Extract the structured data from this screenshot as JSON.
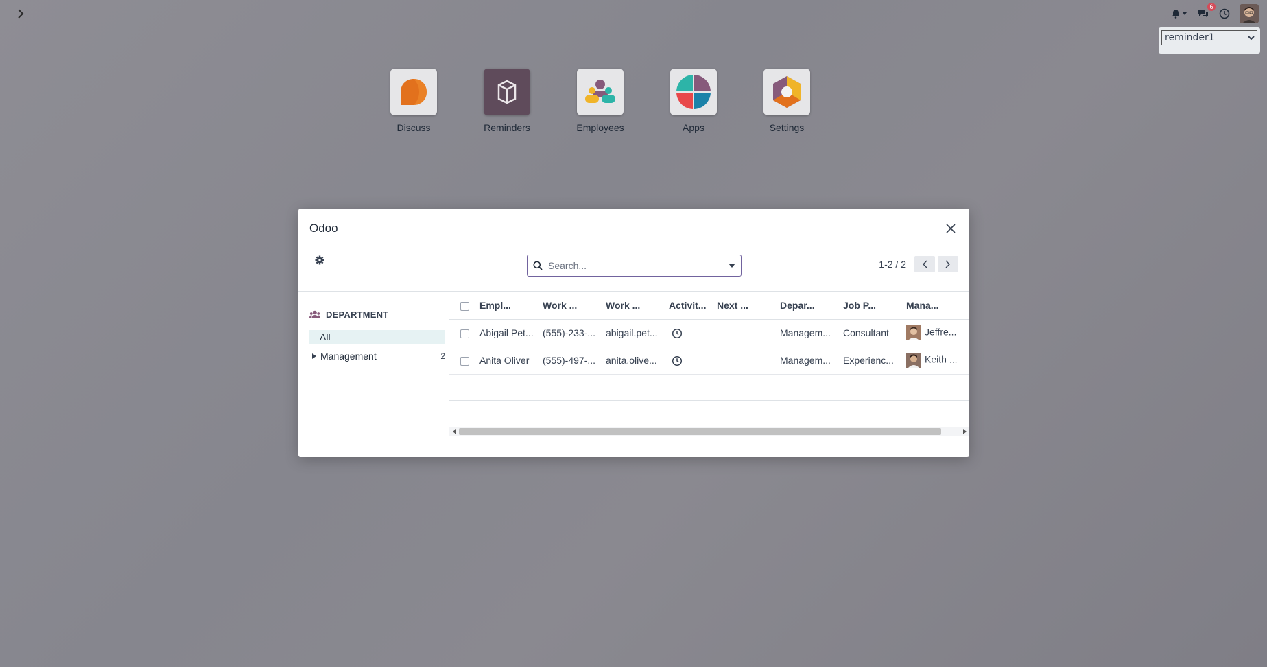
{
  "top": {
    "systray": {
      "messages_badge": "6"
    },
    "reminder_select": {
      "value": "reminder1",
      "options": [
        "reminder1"
      ]
    }
  },
  "apps": [
    {
      "label": "Discuss",
      "icon": "discuss-icon"
    },
    {
      "label": "Reminders",
      "icon": "reminders-icon"
    },
    {
      "label": "Employees",
      "icon": "employees-icon"
    },
    {
      "label": "Apps",
      "icon": "apps-icon"
    },
    {
      "label": "Settings",
      "icon": "settings-icon"
    }
  ],
  "dialog": {
    "title": "Odoo",
    "search": {
      "placeholder": "Search..."
    },
    "pager": {
      "value": "1-2 / 2"
    },
    "sidebar": {
      "header": "DEPARTMENT",
      "all_label": "All",
      "items": [
        {
          "label": "Management",
          "count": "2"
        }
      ]
    },
    "table": {
      "columns": [
        "Empl...",
        "Work ...",
        "Work ...",
        "Activit...",
        "Next ...",
        "Depar...",
        "Job P...",
        "Mana..."
      ],
      "rows": [
        {
          "name": "Abigail Pet...",
          "phone": "(555)-233-...",
          "email": "abigail.pet...",
          "next": "",
          "department": "Managem...",
          "job": "Consultant",
          "manager": "Jeffre..."
        },
        {
          "name": "Anita Oliver",
          "phone": "(555)-497-...",
          "email": "anita.olive...",
          "next": "",
          "department": "Managem...",
          "job": "Experienc...",
          "manager": "Keith ..."
        }
      ]
    }
  },
  "colors": {
    "brand": "#71639e",
    "selected_bg": "#e6f2f3",
    "badge": "#d44c59"
  }
}
